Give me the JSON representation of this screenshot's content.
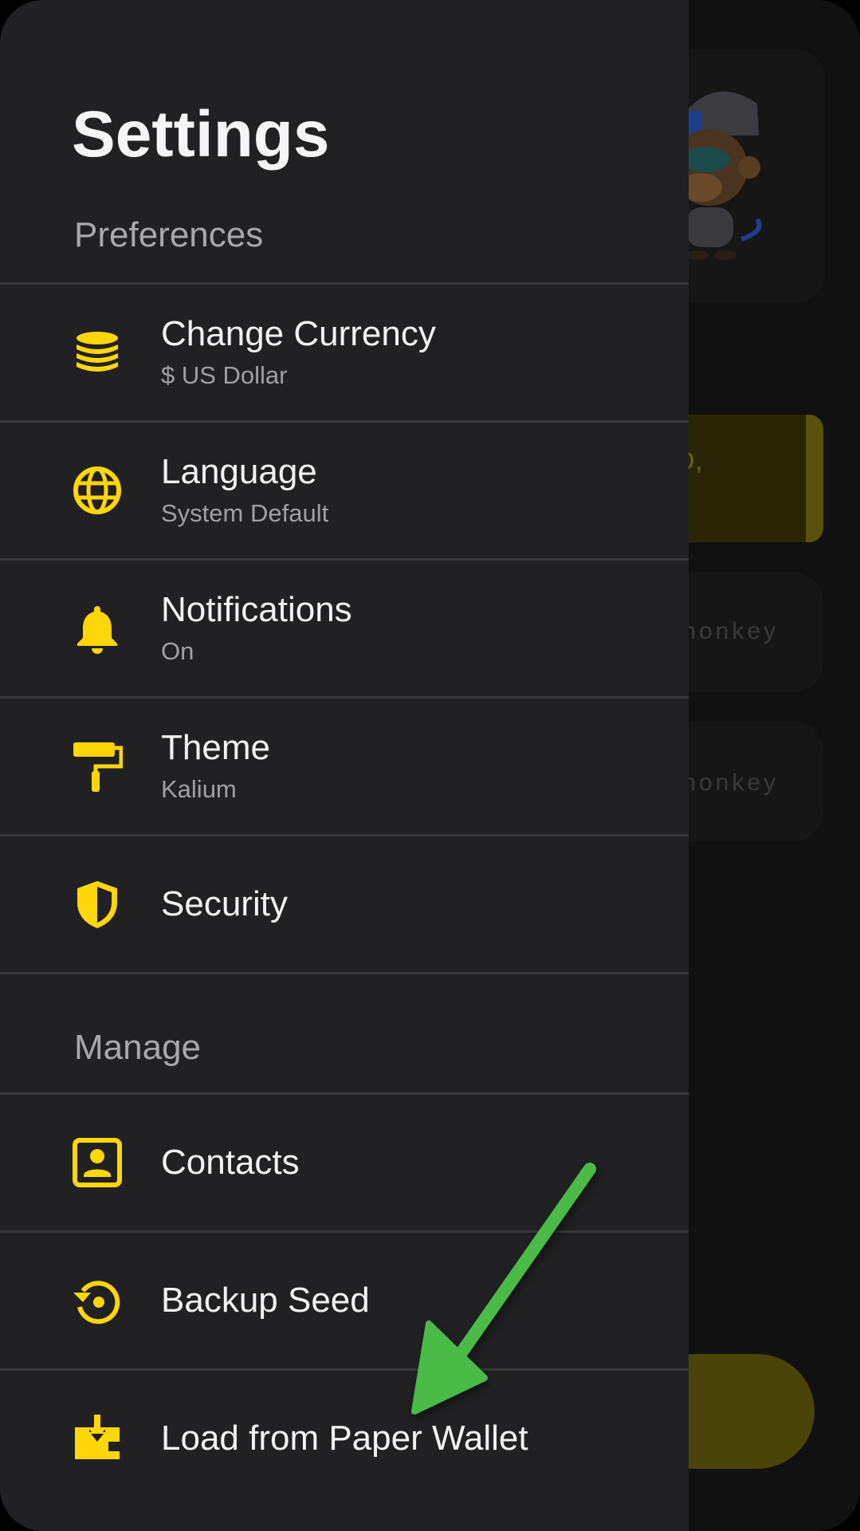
{
  "colors": {
    "accent": "#FFD60A",
    "drawer_bg": "#212123",
    "divider": "#38383B",
    "arrow": "#4CBB47"
  },
  "drawer": {
    "title": "Settings",
    "sections": {
      "preferences_label": "Preferences",
      "manage_label": "Manage"
    },
    "preferences": [
      {
        "title": "Change Currency",
        "subtitle": "$ US Dollar",
        "icon": "coins-stack-icon"
      },
      {
        "title": "Language",
        "subtitle": "System Default",
        "icon": "globe-icon"
      },
      {
        "title": "Notifications",
        "subtitle": "On",
        "icon": "bell-icon"
      },
      {
        "title": "Theme",
        "subtitle": "Kalium",
        "icon": "paint-roller-icon"
      },
      {
        "title": "Security",
        "icon": "shield-icon"
      }
    ],
    "manage": [
      {
        "title": "Contacts",
        "icon": "contact-card-icon"
      },
      {
        "title": "Backup Seed",
        "icon": "backup-restore-icon"
      },
      {
        "title": "Load from Paper Wallet",
        "icon": "download-wallet-icon"
      }
    ]
  },
  "background": {
    "banner_text": "ANO,",
    "row_texts": [
      "monkey",
      "monkey"
    ]
  }
}
